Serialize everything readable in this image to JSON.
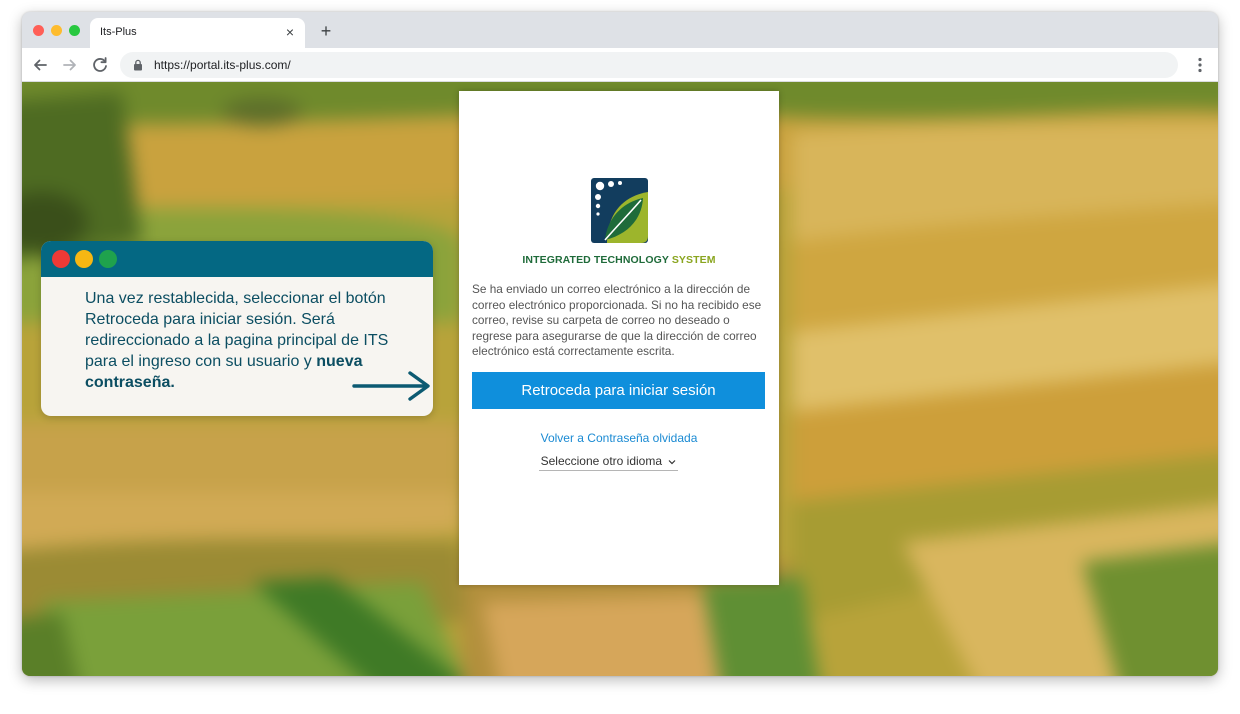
{
  "browser": {
    "tab_title": "Its-Plus",
    "tab_close_icon": "×",
    "new_tab_icon": "+",
    "url": "https://portal.its-plus.com/"
  },
  "login": {
    "brand_part1": "INTEGRATED TECHNOLOGY",
    "brand_part2": "SYSTEM",
    "message": "Se ha enviado un correo electrónico a la dirección de correo electrónico proporcionada. Si no ha recibido ese correo, revise su carpeta de correo no deseado o regrese para asegurarse de que la dirección de correo electrónico está correctamente escrita.",
    "primary_button": "Retroceda para iniciar sesión",
    "back_link": "Volver a Contraseña olvidada",
    "language_select": "Seleccione otro idioma"
  },
  "callout": {
    "text": "Una vez restablecida, seleccionar el botón Retroceda para iniciar sesión. Será redireccionado a la pagina principal de ITS para el ingreso con su usuario y ",
    "bold_text": "nueva contraseña."
  },
  "colors": {
    "primary_button": "#0f8fdc",
    "link": "#1a8ad3",
    "callout_bar": "#046883",
    "callout_text": "#0c4e62",
    "brand_green": "#1f6b3a",
    "brand_lime": "#8aa51f"
  },
  "icons": {
    "back": "arrow-left-icon",
    "forward": "arrow-right-icon",
    "reload": "reload-icon",
    "lock": "lock-icon",
    "menu": "vertical-dots-icon",
    "logo": "leaf-logo-icon",
    "chevron": "chevron-down-icon",
    "callout_arrow": "arrow-right-icon"
  }
}
